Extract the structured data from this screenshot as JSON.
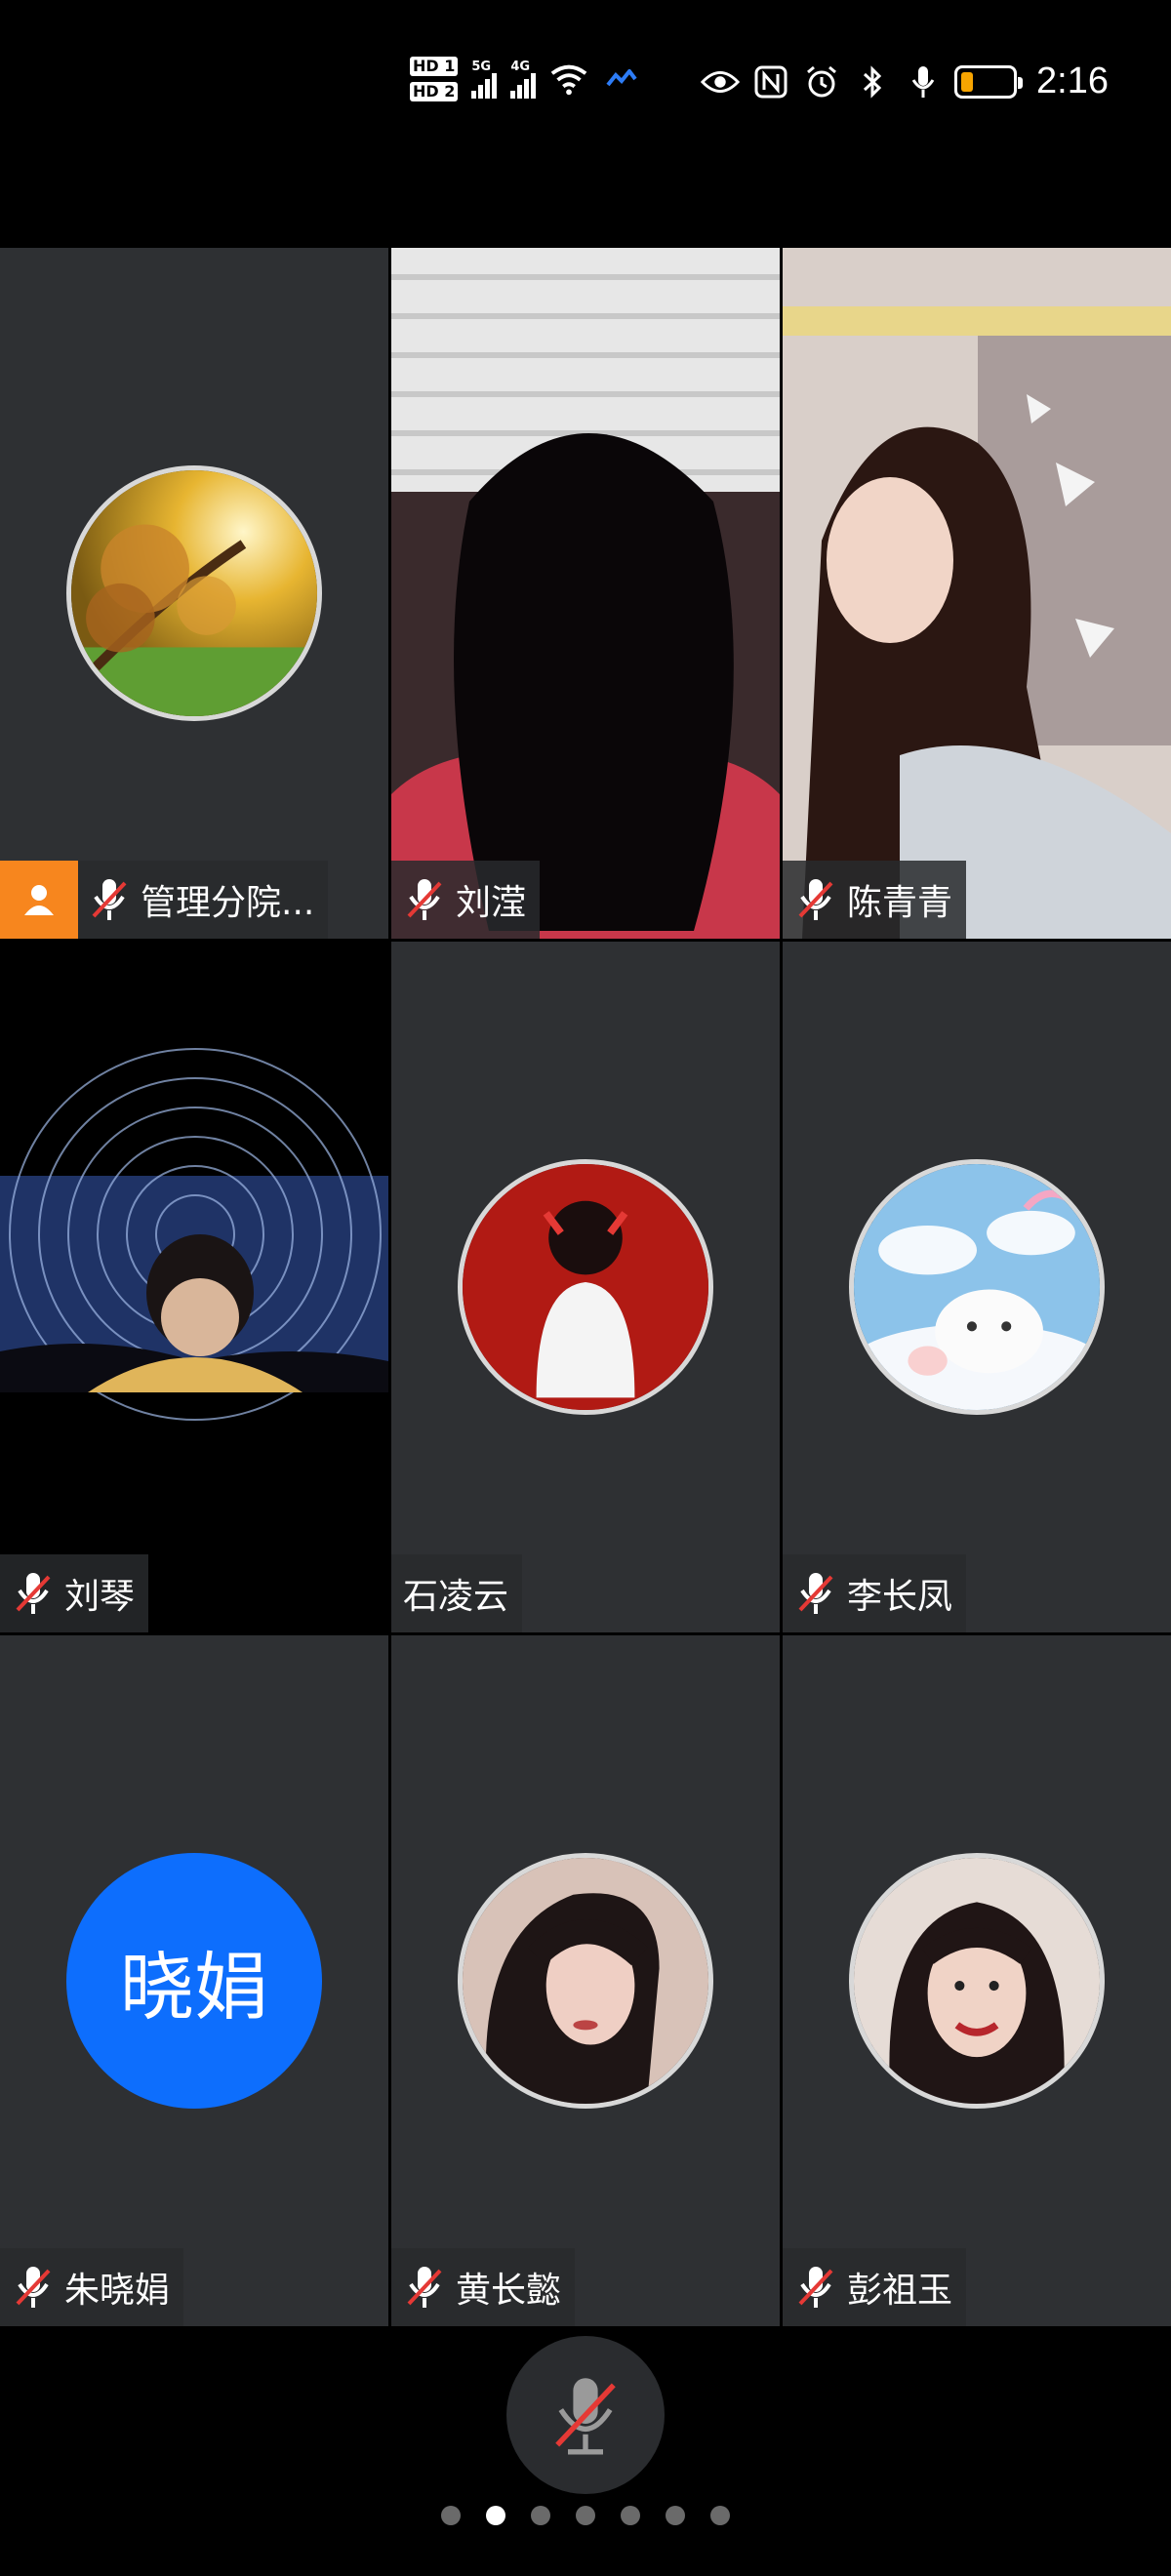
{
  "status_bar": {
    "hd1": "HD 1",
    "hd2": "HD 2",
    "net1": "5G",
    "net2": "4G",
    "wifi_tag": "6",
    "time": "2:16",
    "battery_level": 0.15,
    "battery_color": "#f7a400",
    "icons": [
      "eye-icon",
      "nfc-icon",
      "alarm-icon",
      "bluetooth-icon",
      "microphone-icon"
    ]
  },
  "participants": [
    {
      "name": "管理分院...",
      "host": true,
      "muted": true,
      "avatar": "autumn-tree-avatar"
    },
    {
      "name": "刘滢",
      "muted": true,
      "video": "person-video"
    },
    {
      "name": "陈青青",
      "muted": true,
      "video": "woman-video"
    },
    {
      "name": "刘琴",
      "muted": true,
      "video": "star-trail-video"
    },
    {
      "name": "石凌云",
      "muted": false,
      "avatar": "girl-red-background-avatar"
    },
    {
      "name": "李长凤",
      "muted": true,
      "avatar": "cloud-cat-avatar"
    },
    {
      "name": "朱晓娟",
      "muted": true,
      "avatar_text": "晓娟",
      "avatar_color": "#0d6efd"
    },
    {
      "name": "黄长懿",
      "muted": true,
      "avatar": "woman-portrait-avatar"
    },
    {
      "name": "彭祖玉",
      "muted": true,
      "avatar": "smiling-woman-avatar"
    }
  ],
  "pagination": {
    "total": 7,
    "active": 2
  },
  "colors": {
    "tile_bg": "#2e3033",
    "host_badge": "#f7861e",
    "mute_slash": "#e53935"
  }
}
